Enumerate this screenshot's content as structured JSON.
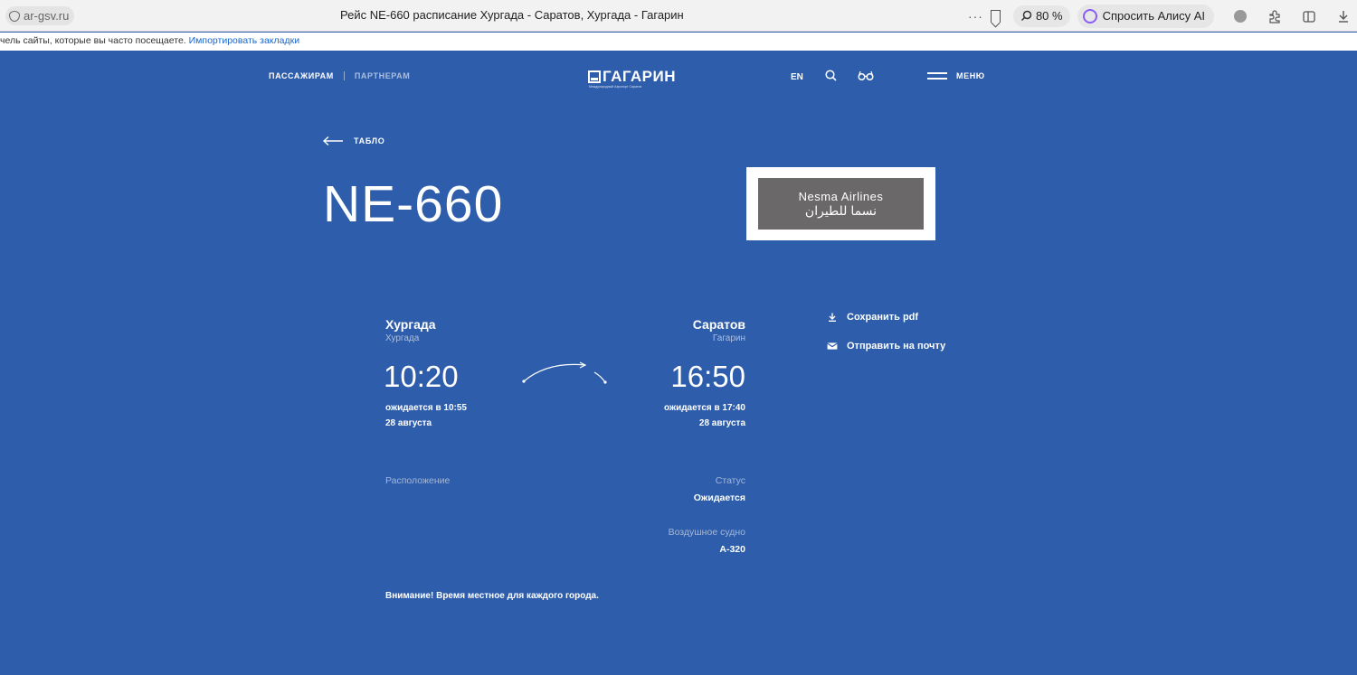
{
  "browser": {
    "url": "ar-gsv.ru",
    "tab_title": "Рейс NE-660 расписание Хургада - Саратов, Хургада - Гагарин",
    "dots": "···",
    "zoom": "80 %",
    "alice_label": "Спросить Алису AI",
    "bookmarks_text": "чель сайты, которые вы часто посещаете.",
    "bookmarks_link": "Импортировать закладки"
  },
  "nav": {
    "passengers": "ПАССАЖИРАМ",
    "partners": "ПАРТНЕРАМ",
    "logo": "ГАГАРИН",
    "logo_sub": "Международный Аэропорт Саратов",
    "lang": "EN",
    "menu": "МЕНЮ"
  },
  "flight": {
    "back_label": "ТАБЛО",
    "number": "NE-660",
    "airline_en": "Nesma Airlines",
    "airline_ar": "نسما للطيران",
    "departure": {
      "city": "Хургада",
      "airport": "Хургада",
      "time": "10:20",
      "expected": "ожидается в 10:55",
      "date": "28 августа"
    },
    "arrival": {
      "city": "Саратов",
      "airport": "Гагарин",
      "time": "16:50",
      "expected": "ожидается в 17:40",
      "date": "28 августа"
    },
    "actions": {
      "save_pdf": "Сохранить pdf",
      "send_mail": "Отправить на почту"
    },
    "location_label": "Расположение",
    "status_label": "Статус",
    "status_value": "Ожидается",
    "aircraft_label": "Воздушное судно",
    "aircraft_value": "A-320",
    "notice": "Внимание! Время местное для каждого города."
  },
  "colors": {
    "background": "#2e5dab",
    "airline_logo_bg": "#6a6868"
  }
}
